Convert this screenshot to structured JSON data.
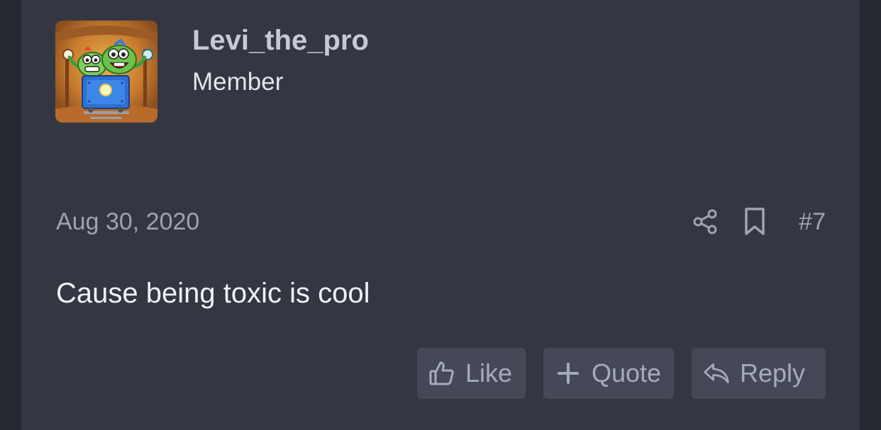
{
  "user": {
    "username": "Levi_the_pro",
    "role": "Member",
    "avatar_icon": "cartoon-avatar-icon"
  },
  "post": {
    "date": "Aug 30, 2020",
    "number": "#7",
    "message": "Cause being toxic is cool"
  },
  "actions": {
    "share_icon": "share-icon",
    "bookmark_icon": "bookmark-icon",
    "like_label": "Like",
    "quote_label": "Quote",
    "reply_label": "Reply"
  },
  "colors": {
    "page_background": "#262931",
    "post_background": "#343742",
    "button_background": "#454957",
    "username": "#c6cad8",
    "muted_text": "#9ea3b2",
    "body_text": "#eef0f5"
  }
}
